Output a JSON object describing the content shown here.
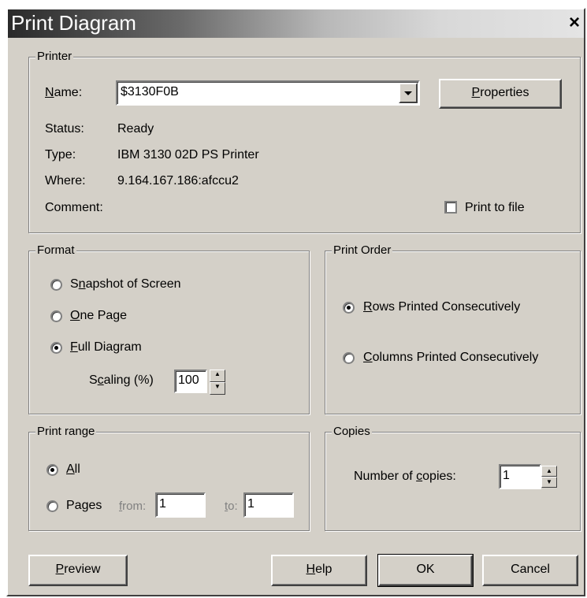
{
  "window": {
    "title": "Print Diagram",
    "close_glyph": "×"
  },
  "printer": {
    "legend": "Printer",
    "name_label": "Name:",
    "name_value": "$3130F0B",
    "properties_label": "Properties",
    "status_label": "Status:",
    "status_value": "Ready",
    "type_label": "Type:",
    "type_value": "IBM 3130 02D PS Printer",
    "where_label": "Where:",
    "where_value": "9.164.167.186:afccu2",
    "comment_label": "Comment:",
    "print_to_file_label": "Print to file",
    "print_to_file_checked": false
  },
  "format": {
    "legend": "Format",
    "options": [
      {
        "label": "Snapshot of Screen",
        "checked": false
      },
      {
        "label": "One Page",
        "checked": false
      },
      {
        "label": "Full Diagram",
        "checked": true
      }
    ],
    "scaling_label": "Scaling (%)",
    "scaling_value": "100"
  },
  "print_order": {
    "legend": "Print Order",
    "options": [
      {
        "label": "Rows Printed Consecutively",
        "checked": true
      },
      {
        "label": "Columns Printed Consecutively",
        "checked": false
      }
    ]
  },
  "print_range": {
    "legend": "Print range",
    "all_label": "All",
    "pages_label": "Pages",
    "from_label": "from:",
    "from_value": "1",
    "to_label": "to:",
    "to_value": "1",
    "selected": "All"
  },
  "copies": {
    "legend": "Copies",
    "number_label": "Number of copies:",
    "number_value": "1"
  },
  "buttons": {
    "preview": "Preview",
    "help": "Help",
    "ok": "OK",
    "cancel": "Cancel"
  },
  "icons": {
    "dropdown": "dropdown-arrow-icon",
    "spin_up": "spin-up-icon",
    "spin_down": "spin-down-icon",
    "close": "close-icon"
  }
}
